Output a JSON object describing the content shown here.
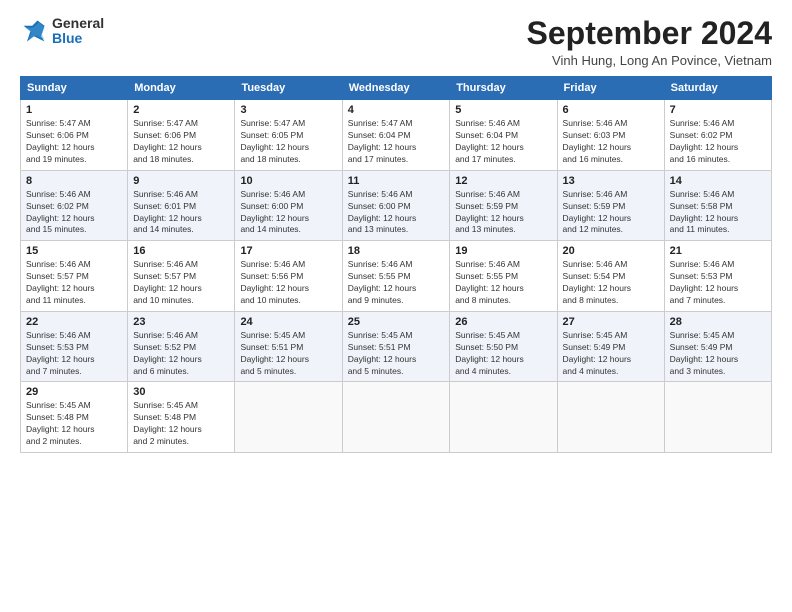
{
  "logo": {
    "general": "General",
    "blue": "Blue"
  },
  "title": "September 2024",
  "location": "Vinh Hung, Long An Povince, Vietnam",
  "weekdays": [
    "Sunday",
    "Monday",
    "Tuesday",
    "Wednesday",
    "Thursday",
    "Friday",
    "Saturday"
  ],
  "weeks": [
    [
      {
        "day": "1",
        "detail": "Sunrise: 5:47 AM\nSunset: 6:06 PM\nDaylight: 12 hours\nand 19 minutes."
      },
      {
        "day": "2",
        "detail": "Sunrise: 5:47 AM\nSunset: 6:06 PM\nDaylight: 12 hours\nand 18 minutes."
      },
      {
        "day": "3",
        "detail": "Sunrise: 5:47 AM\nSunset: 6:05 PM\nDaylight: 12 hours\nand 18 minutes."
      },
      {
        "day": "4",
        "detail": "Sunrise: 5:47 AM\nSunset: 6:04 PM\nDaylight: 12 hours\nand 17 minutes."
      },
      {
        "day": "5",
        "detail": "Sunrise: 5:46 AM\nSunset: 6:04 PM\nDaylight: 12 hours\nand 17 minutes."
      },
      {
        "day": "6",
        "detail": "Sunrise: 5:46 AM\nSunset: 6:03 PM\nDaylight: 12 hours\nand 16 minutes."
      },
      {
        "day": "7",
        "detail": "Sunrise: 5:46 AM\nSunset: 6:02 PM\nDaylight: 12 hours\nand 16 minutes."
      }
    ],
    [
      {
        "day": "8",
        "detail": "Sunrise: 5:46 AM\nSunset: 6:02 PM\nDaylight: 12 hours\nand 15 minutes."
      },
      {
        "day": "9",
        "detail": "Sunrise: 5:46 AM\nSunset: 6:01 PM\nDaylight: 12 hours\nand 14 minutes."
      },
      {
        "day": "10",
        "detail": "Sunrise: 5:46 AM\nSunset: 6:00 PM\nDaylight: 12 hours\nand 14 minutes."
      },
      {
        "day": "11",
        "detail": "Sunrise: 5:46 AM\nSunset: 6:00 PM\nDaylight: 12 hours\nand 13 minutes."
      },
      {
        "day": "12",
        "detail": "Sunrise: 5:46 AM\nSunset: 5:59 PM\nDaylight: 12 hours\nand 13 minutes."
      },
      {
        "day": "13",
        "detail": "Sunrise: 5:46 AM\nSunset: 5:59 PM\nDaylight: 12 hours\nand 12 minutes."
      },
      {
        "day": "14",
        "detail": "Sunrise: 5:46 AM\nSunset: 5:58 PM\nDaylight: 12 hours\nand 11 minutes."
      }
    ],
    [
      {
        "day": "15",
        "detail": "Sunrise: 5:46 AM\nSunset: 5:57 PM\nDaylight: 12 hours\nand 11 minutes."
      },
      {
        "day": "16",
        "detail": "Sunrise: 5:46 AM\nSunset: 5:57 PM\nDaylight: 12 hours\nand 10 minutes."
      },
      {
        "day": "17",
        "detail": "Sunrise: 5:46 AM\nSunset: 5:56 PM\nDaylight: 12 hours\nand 10 minutes."
      },
      {
        "day": "18",
        "detail": "Sunrise: 5:46 AM\nSunset: 5:55 PM\nDaylight: 12 hours\nand 9 minutes."
      },
      {
        "day": "19",
        "detail": "Sunrise: 5:46 AM\nSunset: 5:55 PM\nDaylight: 12 hours\nand 8 minutes."
      },
      {
        "day": "20",
        "detail": "Sunrise: 5:46 AM\nSunset: 5:54 PM\nDaylight: 12 hours\nand 8 minutes."
      },
      {
        "day": "21",
        "detail": "Sunrise: 5:46 AM\nSunset: 5:53 PM\nDaylight: 12 hours\nand 7 minutes."
      }
    ],
    [
      {
        "day": "22",
        "detail": "Sunrise: 5:46 AM\nSunset: 5:53 PM\nDaylight: 12 hours\nand 7 minutes."
      },
      {
        "day": "23",
        "detail": "Sunrise: 5:46 AM\nSunset: 5:52 PM\nDaylight: 12 hours\nand 6 minutes."
      },
      {
        "day": "24",
        "detail": "Sunrise: 5:45 AM\nSunset: 5:51 PM\nDaylight: 12 hours\nand 5 minutes."
      },
      {
        "day": "25",
        "detail": "Sunrise: 5:45 AM\nSunset: 5:51 PM\nDaylight: 12 hours\nand 5 minutes."
      },
      {
        "day": "26",
        "detail": "Sunrise: 5:45 AM\nSunset: 5:50 PM\nDaylight: 12 hours\nand 4 minutes."
      },
      {
        "day": "27",
        "detail": "Sunrise: 5:45 AM\nSunset: 5:49 PM\nDaylight: 12 hours\nand 4 minutes."
      },
      {
        "day": "28",
        "detail": "Sunrise: 5:45 AM\nSunset: 5:49 PM\nDaylight: 12 hours\nand 3 minutes."
      }
    ],
    [
      {
        "day": "29",
        "detail": "Sunrise: 5:45 AM\nSunset: 5:48 PM\nDaylight: 12 hours\nand 2 minutes."
      },
      {
        "day": "30",
        "detail": "Sunrise: 5:45 AM\nSunset: 5:48 PM\nDaylight: 12 hours\nand 2 minutes."
      },
      {
        "day": "",
        "detail": ""
      },
      {
        "day": "",
        "detail": ""
      },
      {
        "day": "",
        "detail": ""
      },
      {
        "day": "",
        "detail": ""
      },
      {
        "day": "",
        "detail": ""
      }
    ]
  ]
}
